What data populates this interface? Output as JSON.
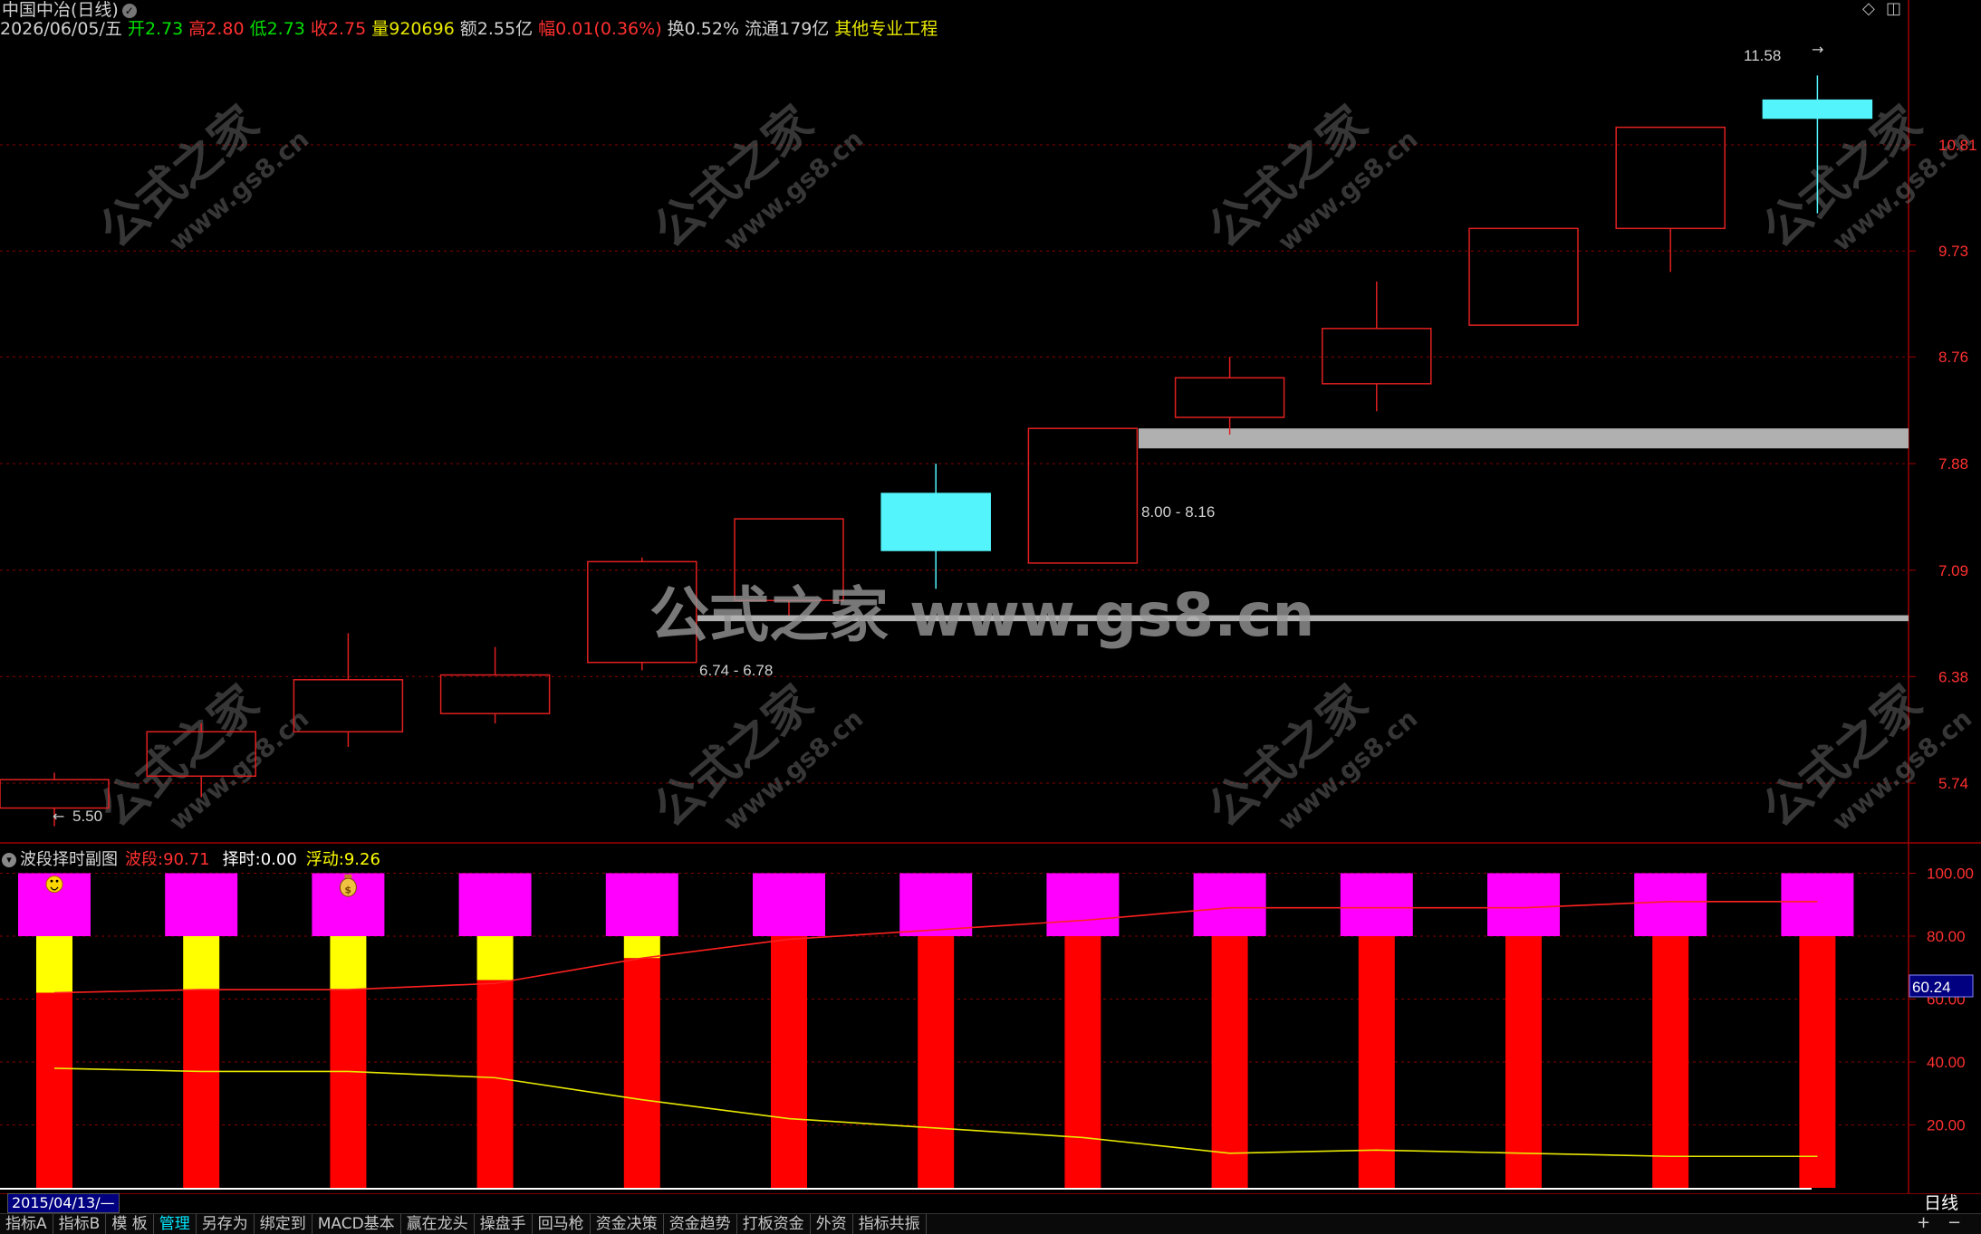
{
  "header": {
    "title": "中国中冶(日线)",
    "date": "2026/06/05/五",
    "open_label": "开",
    "open": "2.73",
    "high_label": "高",
    "high": "2.80",
    "low_label": "低",
    "low": "2.73",
    "close_label": "收",
    "close": "2.75",
    "volume_label": "量",
    "volume": "920696",
    "amount_label": "额",
    "amount": "2.55亿",
    "change_label": "幅",
    "change": "0.01(0.36%)",
    "turnover_label": "换",
    "turnover": "0.52%",
    "float_label": "流通",
    "float": "179亿",
    "industry": "其他专业工程",
    "diamond_icon": "◇",
    "restore_icon": "◫"
  },
  "main_chart": {
    "price_axis": [
      "10.81",
      "9.73",
      "8.76",
      "7.88",
      "7.09",
      "6.38",
      "5.74"
    ],
    "max_label": "11.58",
    "min_label": "5.50",
    "zone_upper_label": "8.00 - 8.16",
    "zone_lower_label": "6.74 - 6.78",
    "watermark_main": "公式之家 www.gs8.cn",
    "watermark_tile_cn": "公式之家",
    "watermark_tile_url": "www.gs8.cn",
    "candles": [
      {
        "o": 5.6,
        "c": 5.76,
        "h": 5.8,
        "l": 5.5,
        "up": true
      },
      {
        "o": 5.78,
        "c": 6.04,
        "h": 6.09,
        "l": 5.66,
        "up": true
      },
      {
        "o": 6.04,
        "c": 6.36,
        "h": 6.66,
        "l": 5.95,
        "up": true
      },
      {
        "o": 6.15,
        "c": 6.39,
        "h": 6.57,
        "l": 6.09,
        "up": true
      },
      {
        "o": 6.47,
        "c": 7.15,
        "h": 7.18,
        "l": 6.42,
        "up": true
      },
      {
        "o": 6.88,
        "c": 7.46,
        "h": 7.46,
        "l": 6.78,
        "up": true
      },
      {
        "o": 7.65,
        "c": 7.23,
        "h": 7.88,
        "l": 6.96,
        "up": false
      },
      {
        "o": 7.14,
        "c": 8.16,
        "h": 8.16,
        "l": 7.14,
        "up": true
      },
      {
        "o": 8.25,
        "c": 8.58,
        "h": 8.76,
        "l": 8.11,
        "up": true
      },
      {
        "o": 8.53,
        "c": 9.01,
        "h": 9.44,
        "l": 8.3,
        "up": true
      },
      {
        "o": 9.04,
        "c": 9.95,
        "h": 9.95,
        "l": 9.04,
        "up": true
      },
      {
        "o": 9.95,
        "c": 11.0,
        "h": 11.0,
        "l": 9.53,
        "up": true
      },
      {
        "o": 11.3,
        "c": 11.1,
        "h": 11.58,
        "l": 10.1,
        "up": false
      }
    ]
  },
  "sub_chart": {
    "title": "波段择时副图",
    "band_label": "波段:",
    "band_value": "90.71",
    "timing_label": "择时:",
    "timing_value": "0.00",
    "float_label": "浮动:",
    "float_value": "9.26",
    "axis": [
      "100.00",
      "80.00",
      "60.00",
      "40.00",
      "20.00"
    ],
    "current_value_box": "60.24",
    "bars": [
      {
        "red": 62,
        "yellow": 80,
        "icon": "smile"
      },
      {
        "red": 63,
        "yellow": 80,
        "icon": ""
      },
      {
        "red": 63,
        "yellow": 80,
        "icon": "moneybag"
      },
      {
        "red": 66,
        "yellow": 80,
        "icon": ""
      },
      {
        "red": 73,
        "yellow": 80,
        "icon": ""
      },
      {
        "red": 80,
        "yellow": 80,
        "icon": ""
      },
      {
        "red": 80,
        "yellow": 80,
        "icon": ""
      },
      {
        "red": 80,
        "yellow": 80,
        "icon": ""
      },
      {
        "red": 80,
        "yellow": 80,
        "icon": ""
      },
      {
        "red": 80,
        "yellow": 80,
        "icon": ""
      },
      {
        "red": 80,
        "yellow": 80,
        "icon": ""
      },
      {
        "red": 80,
        "yellow": 80,
        "icon": ""
      },
      {
        "red": 80,
        "yellow": 80,
        "icon": ""
      }
    ],
    "red_line": [
      62,
      63,
      63,
      65,
      73,
      79,
      82,
      85,
      89,
      89,
      89,
      91,
      91
    ],
    "yellow_line": [
      38,
      37,
      37,
      35,
      28,
      22,
      19,
      16,
      11,
      12,
      11,
      10,
      10
    ]
  },
  "footer": {
    "date_field": "2015/04/13/—",
    "period": "日线",
    "tabs": [
      "指标A",
      "指标B",
      "模 板",
      "管理",
      "另存为",
      "绑定到",
      "MACD基本",
      "赢在龙头",
      "操盘手",
      "回马枪",
      "资金决策",
      "资金趋势",
      "打板资金",
      "外资",
      "指标共振"
    ],
    "active_tab": "管理",
    "plus": "+",
    "minus": "−"
  },
  "colors": {
    "up_candle": "#e02020",
    "down_candle": "#54f4fc",
    "zone": "#b0b0b0",
    "magenta": "#ff00ff",
    "bar_red": "#ff0000",
    "bar_yellow": "#ffff00",
    "grid": "#8a0000"
  }
}
